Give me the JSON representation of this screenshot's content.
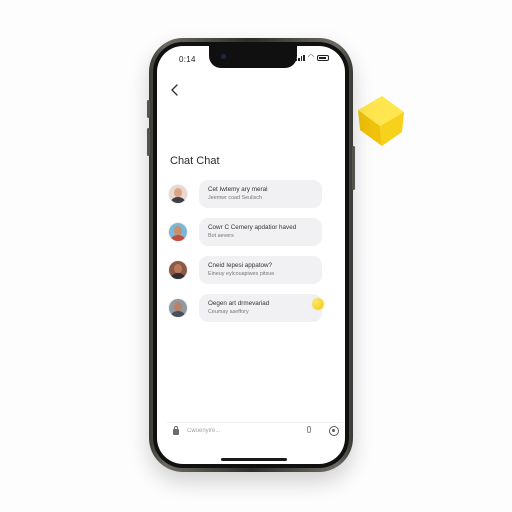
{
  "status_bar": {
    "time": "0:14"
  },
  "header": {
    "back_icon": "chevron-left-icon",
    "title": "Chat Chat"
  },
  "chats": [
    {
      "line1": "Cet Iwtemy ary meral",
      "line2": "Jeemwr coad Seulisch",
      "avatar_skin": "#d9a584",
      "avatar_bg": "#e9d8cf",
      "avatar_shirt": "#3c3f47"
    },
    {
      "line1": "Cowr C Cemery apdatior haved",
      "line2": "Bot aevers",
      "avatar_skin": "#c98f6b",
      "avatar_bg": "#7ab7d8",
      "avatar_shirt": "#c44c3b"
    },
    {
      "line1": "Cneid Iepesi appatow?",
      "line2": "Eineuy eylcouapiwes pitsue",
      "avatar_skin": "#b9795a",
      "avatar_bg": "#8a5a46",
      "avatar_shirt": "#2f2f33"
    },
    {
      "line1": "Oegen art drmevariad",
      "line2": "Ceumay aseffory",
      "avatar_skin": "#b98267",
      "avatar_bg": "#8f9aa3",
      "avatar_shirt": "#4a4f58",
      "has_accent_dot": true
    }
  ],
  "input": {
    "placeholder": "Cwuenyire..."
  },
  "colors": {
    "accent": "#f6d21c",
    "bubble": "#f1f1f4"
  }
}
